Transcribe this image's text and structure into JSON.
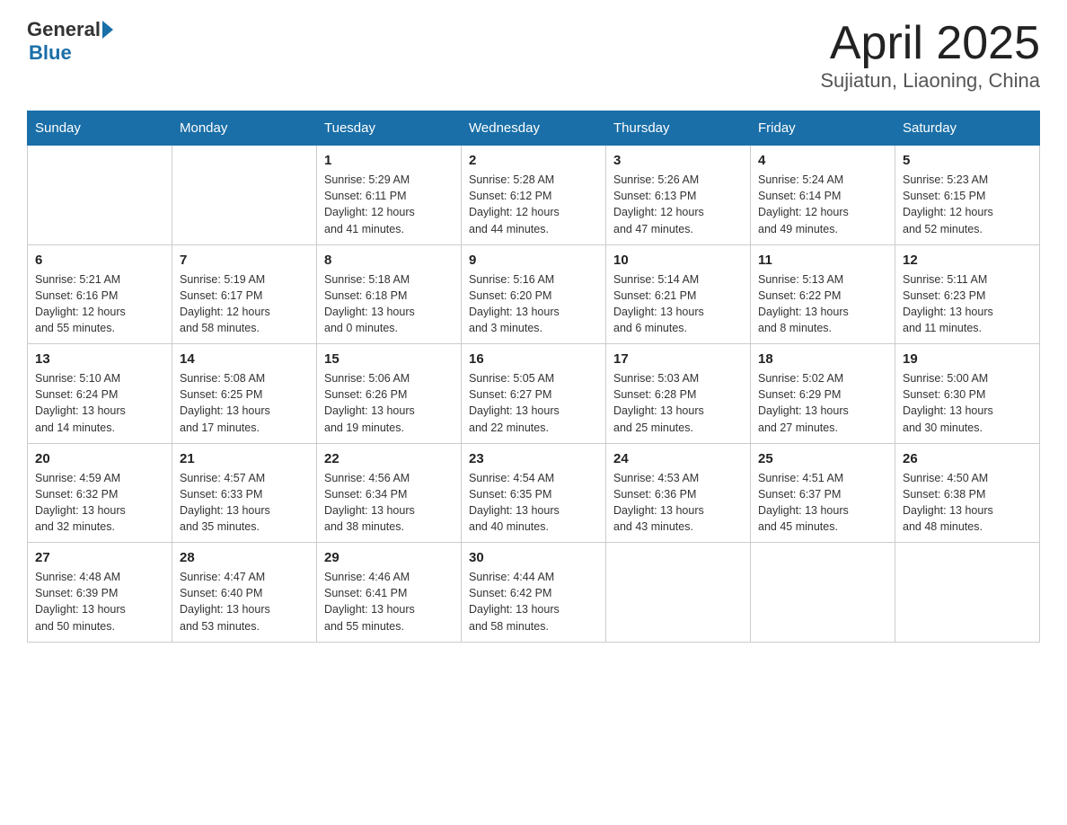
{
  "header": {
    "logo_general": "General",
    "logo_blue": "Blue",
    "title": "April 2025",
    "subtitle": "Sujiatun, Liaoning, China"
  },
  "calendar": {
    "days_of_week": [
      "Sunday",
      "Monday",
      "Tuesday",
      "Wednesday",
      "Thursday",
      "Friday",
      "Saturday"
    ],
    "weeks": [
      [
        {
          "day": "",
          "info": ""
        },
        {
          "day": "",
          "info": ""
        },
        {
          "day": "1",
          "info": "Sunrise: 5:29 AM\nSunset: 6:11 PM\nDaylight: 12 hours\nand 41 minutes."
        },
        {
          "day": "2",
          "info": "Sunrise: 5:28 AM\nSunset: 6:12 PM\nDaylight: 12 hours\nand 44 minutes."
        },
        {
          "day": "3",
          "info": "Sunrise: 5:26 AM\nSunset: 6:13 PM\nDaylight: 12 hours\nand 47 minutes."
        },
        {
          "day": "4",
          "info": "Sunrise: 5:24 AM\nSunset: 6:14 PM\nDaylight: 12 hours\nand 49 minutes."
        },
        {
          "day": "5",
          "info": "Sunrise: 5:23 AM\nSunset: 6:15 PM\nDaylight: 12 hours\nand 52 minutes."
        }
      ],
      [
        {
          "day": "6",
          "info": "Sunrise: 5:21 AM\nSunset: 6:16 PM\nDaylight: 12 hours\nand 55 minutes."
        },
        {
          "day": "7",
          "info": "Sunrise: 5:19 AM\nSunset: 6:17 PM\nDaylight: 12 hours\nand 58 minutes."
        },
        {
          "day": "8",
          "info": "Sunrise: 5:18 AM\nSunset: 6:18 PM\nDaylight: 13 hours\nand 0 minutes."
        },
        {
          "day": "9",
          "info": "Sunrise: 5:16 AM\nSunset: 6:20 PM\nDaylight: 13 hours\nand 3 minutes."
        },
        {
          "day": "10",
          "info": "Sunrise: 5:14 AM\nSunset: 6:21 PM\nDaylight: 13 hours\nand 6 minutes."
        },
        {
          "day": "11",
          "info": "Sunrise: 5:13 AM\nSunset: 6:22 PM\nDaylight: 13 hours\nand 8 minutes."
        },
        {
          "day": "12",
          "info": "Sunrise: 5:11 AM\nSunset: 6:23 PM\nDaylight: 13 hours\nand 11 minutes."
        }
      ],
      [
        {
          "day": "13",
          "info": "Sunrise: 5:10 AM\nSunset: 6:24 PM\nDaylight: 13 hours\nand 14 minutes."
        },
        {
          "day": "14",
          "info": "Sunrise: 5:08 AM\nSunset: 6:25 PM\nDaylight: 13 hours\nand 17 minutes."
        },
        {
          "day": "15",
          "info": "Sunrise: 5:06 AM\nSunset: 6:26 PM\nDaylight: 13 hours\nand 19 minutes."
        },
        {
          "day": "16",
          "info": "Sunrise: 5:05 AM\nSunset: 6:27 PM\nDaylight: 13 hours\nand 22 minutes."
        },
        {
          "day": "17",
          "info": "Sunrise: 5:03 AM\nSunset: 6:28 PM\nDaylight: 13 hours\nand 25 minutes."
        },
        {
          "day": "18",
          "info": "Sunrise: 5:02 AM\nSunset: 6:29 PM\nDaylight: 13 hours\nand 27 minutes."
        },
        {
          "day": "19",
          "info": "Sunrise: 5:00 AM\nSunset: 6:30 PM\nDaylight: 13 hours\nand 30 minutes."
        }
      ],
      [
        {
          "day": "20",
          "info": "Sunrise: 4:59 AM\nSunset: 6:32 PM\nDaylight: 13 hours\nand 32 minutes."
        },
        {
          "day": "21",
          "info": "Sunrise: 4:57 AM\nSunset: 6:33 PM\nDaylight: 13 hours\nand 35 minutes."
        },
        {
          "day": "22",
          "info": "Sunrise: 4:56 AM\nSunset: 6:34 PM\nDaylight: 13 hours\nand 38 minutes."
        },
        {
          "day": "23",
          "info": "Sunrise: 4:54 AM\nSunset: 6:35 PM\nDaylight: 13 hours\nand 40 minutes."
        },
        {
          "day": "24",
          "info": "Sunrise: 4:53 AM\nSunset: 6:36 PM\nDaylight: 13 hours\nand 43 minutes."
        },
        {
          "day": "25",
          "info": "Sunrise: 4:51 AM\nSunset: 6:37 PM\nDaylight: 13 hours\nand 45 minutes."
        },
        {
          "day": "26",
          "info": "Sunrise: 4:50 AM\nSunset: 6:38 PM\nDaylight: 13 hours\nand 48 minutes."
        }
      ],
      [
        {
          "day": "27",
          "info": "Sunrise: 4:48 AM\nSunset: 6:39 PM\nDaylight: 13 hours\nand 50 minutes."
        },
        {
          "day": "28",
          "info": "Sunrise: 4:47 AM\nSunset: 6:40 PM\nDaylight: 13 hours\nand 53 minutes."
        },
        {
          "day": "29",
          "info": "Sunrise: 4:46 AM\nSunset: 6:41 PM\nDaylight: 13 hours\nand 55 minutes."
        },
        {
          "day": "30",
          "info": "Sunrise: 4:44 AM\nSunset: 6:42 PM\nDaylight: 13 hours\nand 58 minutes."
        },
        {
          "day": "",
          "info": ""
        },
        {
          "day": "",
          "info": ""
        },
        {
          "day": "",
          "info": ""
        }
      ]
    ]
  }
}
